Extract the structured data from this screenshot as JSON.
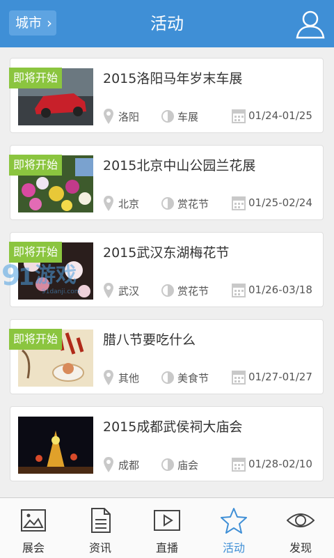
{
  "header": {
    "city_label": "城市",
    "title": "活动"
  },
  "events": [
    {
      "badge": "即将开始",
      "title": "2015洛阳马年岁末车展",
      "location": "洛阳",
      "category": "车展",
      "dates": "01/24-01/25"
    },
    {
      "badge": "即将开始",
      "title": "2015北京中山公园兰花展",
      "location": "北京",
      "category": "赏花节",
      "dates": "01/25-02/24"
    },
    {
      "badge": "即将开始",
      "title": "2015武汉东湖梅花节",
      "location": "武汉",
      "category": "赏花节",
      "dates": "01/26-03/18"
    },
    {
      "badge": "即将开始",
      "title": "腊八节要吃什么",
      "location": "其他",
      "category": "美食节",
      "dates": "01/27-01/27"
    },
    {
      "badge": "",
      "title": "2015成都武侯祠大庙会",
      "location": "成都",
      "category": "庙会",
      "dates": "01/28-02/10"
    }
  ],
  "tabs": [
    {
      "label": "展会",
      "icon": "picture-icon"
    },
    {
      "label": "资讯",
      "icon": "document-icon"
    },
    {
      "label": "直播",
      "icon": "play-icon"
    },
    {
      "label": "活动",
      "icon": "star-icon",
      "active": true
    },
    {
      "label": "发现",
      "icon": "eye-icon"
    }
  ],
  "watermark": {
    "text": "游戏",
    "sub": "91danji.com"
  },
  "colors": {
    "header": "#3f8fd6",
    "badge": "#8bc53f",
    "active_tab": "#3f8fd6"
  }
}
